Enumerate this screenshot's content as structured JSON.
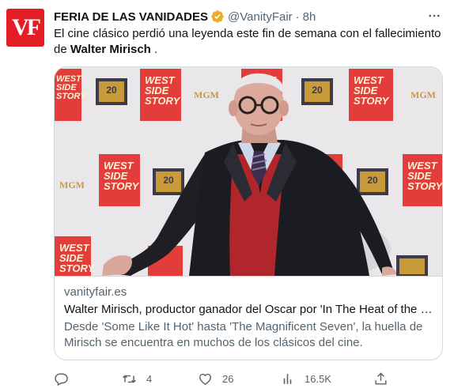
{
  "account": {
    "avatar_text": "VF",
    "display_name": "FERIA DE LAS VANIDADES",
    "handle": "@VanityFair",
    "separator": "·",
    "time": "8h",
    "avatar_color": "#e31e24",
    "verified_color": "#e8b02a"
  },
  "tweet": {
    "text_before": "El cine clásico perdió una leyenda este fin de semana con el fallecimiento de ",
    "text_bold": "Walter Mirisch",
    "text_after": " ."
  },
  "card": {
    "domain": "vanityfair.es",
    "title": "Walter Mirisch, productor ganador del Oscar por 'In The Heat of the Night'",
    "description": "Desde 'Some Like It Hot' hasta 'The Magnificent Seven', la huella de Mirisch se encuentra en muchos de los clásicos del cine.",
    "backdrop": {
      "poster_text": "WEST\nSIDE\nSTORY",
      "fox_text": "20",
      "studio_text": "MGM"
    }
  },
  "actions": {
    "reply_icon": "reply-icon",
    "retweet_icon": "retweet-icon",
    "retweet_count": "4",
    "like_icon": "heart-icon",
    "like_count": "26",
    "views_icon": "views-icon",
    "views_count": "16.5K",
    "share_icon": "share-icon"
  }
}
